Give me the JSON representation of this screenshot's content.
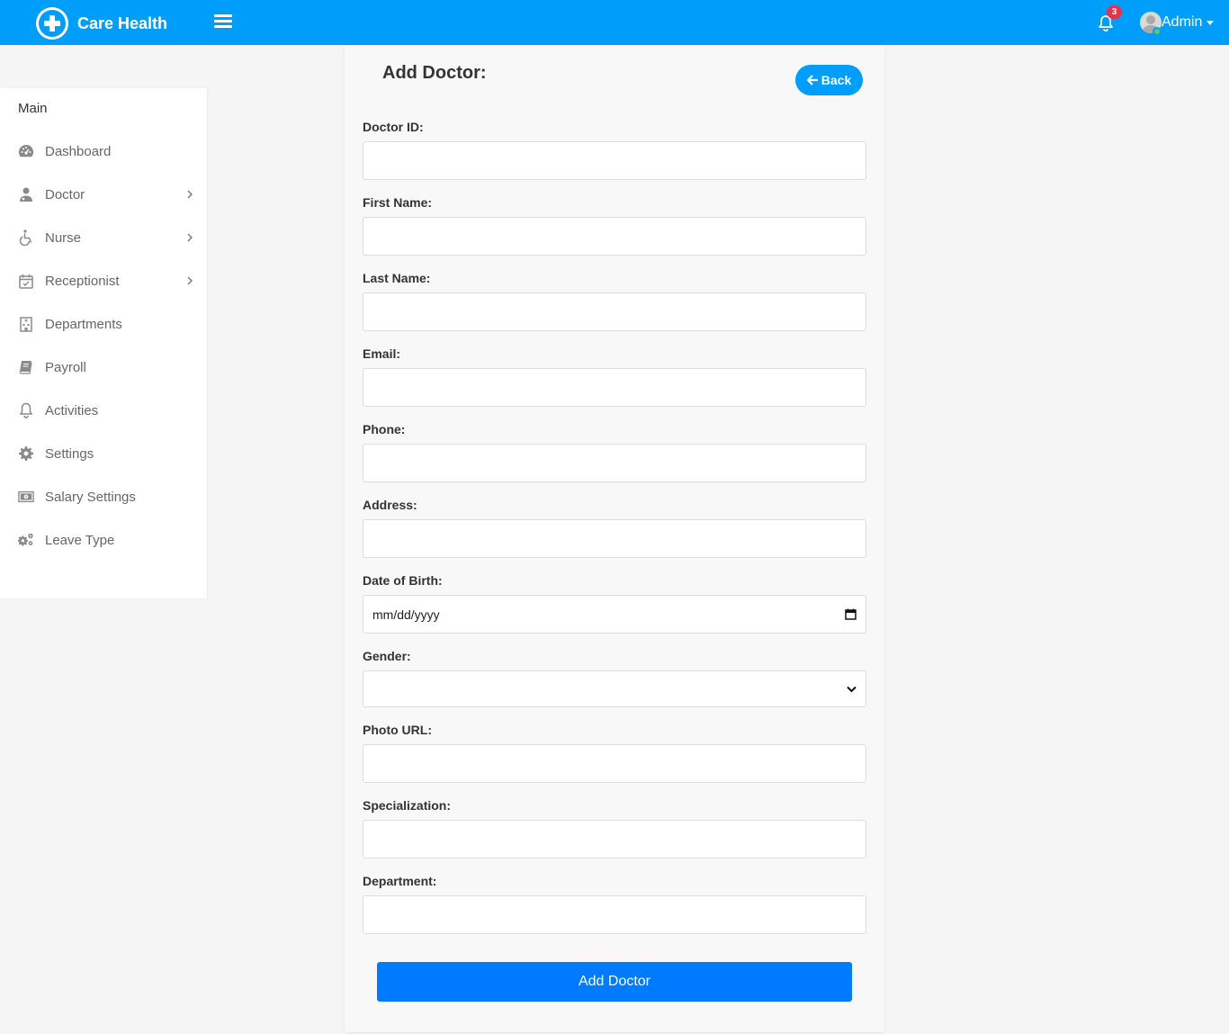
{
  "header": {
    "brand_name": "Care Health",
    "notification_count": "3",
    "user_name": "Admin",
    "accent_color": "#009efb"
  },
  "sidebar": {
    "section_title": "Main",
    "items": [
      {
        "label": "Dashboard",
        "icon": "dashboard-icon",
        "has_submenu": false
      },
      {
        "label": "Doctor",
        "icon": "doctor-icon",
        "has_submenu": true
      },
      {
        "label": "Nurse",
        "icon": "wheelchair-icon",
        "has_submenu": true
      },
      {
        "label": "Receptionist",
        "icon": "calendar-check-icon",
        "has_submenu": true
      },
      {
        "label": "Departments",
        "icon": "hospital-icon",
        "has_submenu": false
      },
      {
        "label": "Payroll",
        "icon": "book-icon",
        "has_submenu": false
      },
      {
        "label": "Activities",
        "icon": "bell-icon",
        "has_submenu": false
      },
      {
        "label": "Settings",
        "icon": "gear-icon",
        "has_submenu": false
      },
      {
        "label": "Salary Settings",
        "icon": "money-icon",
        "has_submenu": false
      },
      {
        "label": "Leave Type",
        "icon": "gears-icon",
        "has_submenu": false
      }
    ]
  },
  "form": {
    "title": "Add Doctor:",
    "back_label": "Back",
    "fields": {
      "doctor_id": {
        "label": "Doctor ID:",
        "value": ""
      },
      "first_name": {
        "label": "First Name:",
        "value": ""
      },
      "last_name": {
        "label": "Last Name:",
        "value": ""
      },
      "email": {
        "label": "Email:",
        "value": ""
      },
      "phone": {
        "label": "Phone:",
        "value": ""
      },
      "address": {
        "label": "Address:",
        "value": ""
      },
      "dob": {
        "label": "Date of Birth:",
        "placeholder": "mm/dd/yyyy"
      },
      "gender": {
        "label": "Gender:",
        "value": ""
      },
      "photo_url": {
        "label": "Photo URL:",
        "value": ""
      },
      "specialization": {
        "label": "Specialization:",
        "value": ""
      },
      "department": {
        "label": "Department:",
        "value": ""
      }
    },
    "submit_label": "Add Doctor",
    "submit_color": "#007bff"
  }
}
